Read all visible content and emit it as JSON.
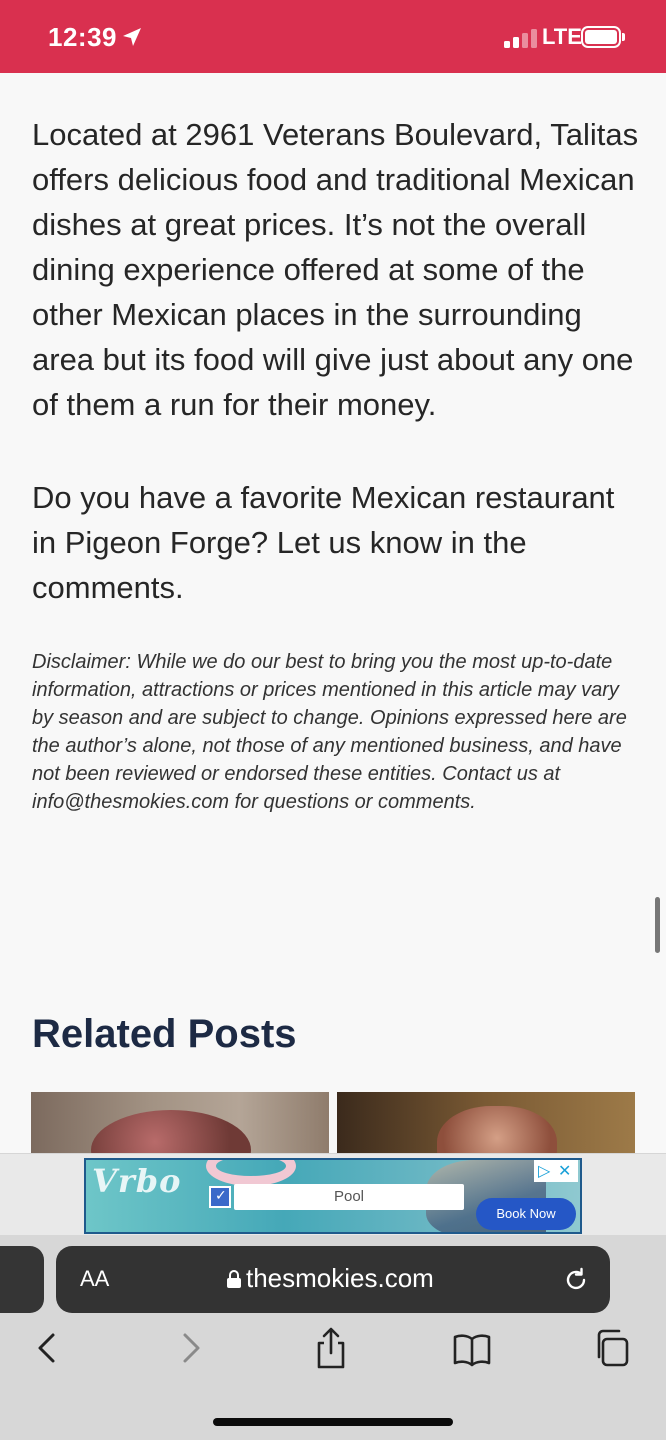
{
  "status_bar": {
    "time": "12:39",
    "network": "LTE",
    "background_color": "#d9304f"
  },
  "article": {
    "paragraphs": [
      "Located at 2961 Veterans Boulevard, Talitas offers delicious food and traditional Mexican dishes at great prices. It’s not the overall dining experience offered at some of the other Mexican places in the surrounding area but its food will give just about any one of them a run for their money.",
      "Do you have a favorite Mexican restaurant in Pigeon Forge? Let us know in the comments."
    ],
    "disclaimer": "Disclaimer: While we do our best to bring you the most up-to-date information, attractions or prices mentioned in this article may vary by season and are subject to change. Opinions expressed here are the author’s alone, not those of any mentioned business, and have not been reviewed or endorsed these entities. Contact us at info@thesmokies.com for questions or comments."
  },
  "related": {
    "title": "Related Posts",
    "title_color": "#1d2a44"
  },
  "ad": {
    "brand": "Vrbo",
    "search_value": "Pool",
    "cta": "Book Now",
    "cta_color": "#2557c6"
  },
  "browser": {
    "text_size_button": "AA",
    "url": "thesmokies.com",
    "icons": [
      "back-icon",
      "forward-icon",
      "share-icon",
      "bookmarks-icon",
      "tabs-icon",
      "reload-icon",
      "lock-icon"
    ]
  }
}
